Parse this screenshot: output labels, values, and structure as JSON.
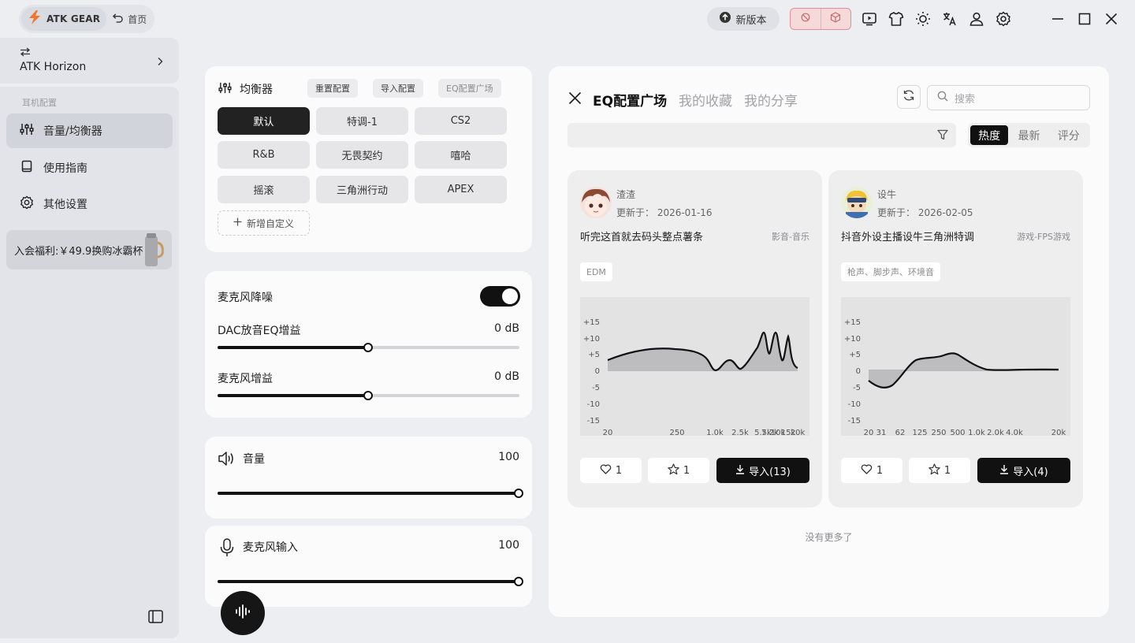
{
  "titlebar": {
    "brand": "ATK GEAR",
    "home_label": "首页",
    "new_version_label": "新版本"
  },
  "sidebar": {
    "device_name": "ATK Horizon",
    "section_label": "耳机配置",
    "items": [
      {
        "label": "音量/均衡器",
        "icon": "sliders-icon",
        "active": true
      },
      {
        "label": "使用指南",
        "icon": "book-icon",
        "active": false
      },
      {
        "label": "其他设置",
        "icon": "gear-icon",
        "active": false
      }
    ],
    "promo_text": "入会福利:￥49.9换购冰霸杯"
  },
  "equalizer": {
    "title": "均衡器",
    "reset_label": "重置配置",
    "import_label": "导入配置",
    "plaza_label": "EQ配置广场",
    "presets": [
      "默认",
      "特调-1",
      "CS2",
      "R&B",
      "无畏契约",
      "嘻哈",
      "摇滚",
      "三角洲行动",
      "APEX"
    ],
    "active_preset": "默认",
    "add_custom_label": "新增自定义"
  },
  "mic_panel": {
    "noise_label": "麦克风降噪",
    "noise_on": true,
    "dac_label": "DAC放音EQ增益",
    "dac_value": "0 dB",
    "dac_level": 0.5,
    "gain_label": "麦克风增益",
    "gain_value": "0 dB",
    "gain_level": 0.5
  },
  "volume": {
    "label": "音量",
    "value": "100",
    "level": 1.0
  },
  "mic_input": {
    "label": "麦克风输入",
    "value": "100",
    "level": 1.0
  },
  "plaza": {
    "tabs": [
      "EQ配置广场",
      "我的收藏",
      "我的分享"
    ],
    "active_tab": "EQ配置广场",
    "search_placeholder": "搜索",
    "sort": [
      "热度",
      "最新",
      "评分"
    ],
    "active_sort": "热度",
    "no_more": "没有更多了",
    "items": [
      {
        "author": "渣渣",
        "updated": "更新于： 2026-01-16",
        "title": "听完这首就去码头整点薯条",
        "category": "影音-音乐",
        "tag": "EDM",
        "likes": "1",
        "favorites": "1",
        "import_label": "导入(13)",
        "y_ticks": [
          "+15",
          "+10",
          "+5",
          "0",
          "-5",
          "-10",
          "-15"
        ],
        "x_ticks": [
          "20",
          "250",
          "1.0k",
          "2.5k",
          "5.5k",
          "7.2k",
          "10k",
          "15k",
          "20k"
        ]
      },
      {
        "author": "设牛",
        "updated": "更新于： 2026-02-05",
        "title": "抖音外设主播设牛三角洲特调",
        "category": "游戏-FPS游戏",
        "tag": "枪声、脚步声、环境音",
        "likes": "1",
        "favorites": "1",
        "import_label": "导入(4)",
        "y_ticks": [
          "+15",
          "+10",
          "+5",
          "0",
          "-5",
          "-10",
          "-15"
        ],
        "x_ticks": [
          "20",
          "31",
          "62",
          "125",
          "250",
          "500",
          "1.0k",
          "2.0k",
          "4.0k",
          "20k"
        ]
      }
    ]
  },
  "colors": {
    "accent": "#111111",
    "brand_orange": "#f0762c",
    "mode_red": "#e38f8f"
  }
}
